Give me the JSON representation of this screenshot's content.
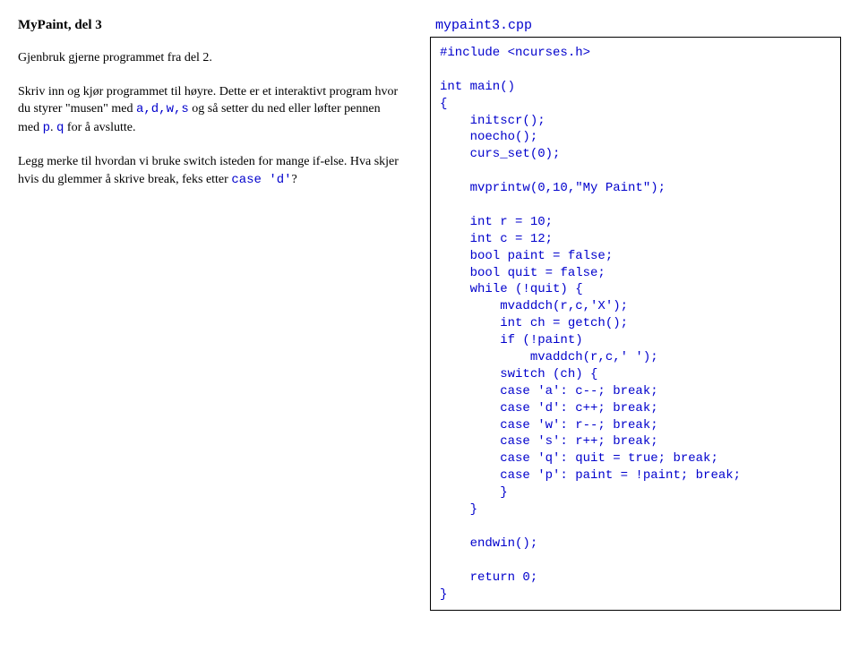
{
  "left": {
    "title": "MyPaint, del 3",
    "p1": "Gjenbruk gjerne programmet fra del 2.",
    "p2_1": "Skriv inn og kjør programmet til høyre. Dette er et interaktivt program hvor du styrer \"musen\" med ",
    "p2_code1": "a,d,w,s",
    "p2_2": " og så setter du ned eller løfter pennen med ",
    "p2_code2": "p",
    "p2_3": ". ",
    "p2_code3": "q",
    "p2_4": " for å avslutte.",
    "p3_1": "Legg merke til hvordan vi bruke switch isteden for mange if-else. Hva skjer hvis du glemmer å skrive break, feks etter ",
    "p3_code1": "case 'd'",
    "p3_2": "?"
  },
  "right": {
    "filename": "mypaint3.cpp",
    "code": "#include <ncurses.h>\n\nint main()\n{\n    initscr();\n    noecho();\n    curs_set(0);\n\n    mvprintw(0,10,\"My Paint\");\n\n    int r = 10;\n    int c = 12;\n    bool paint = false;\n    bool quit = false;\n    while (!quit) {\n        mvaddch(r,c,'X');\n        int ch = getch();\n        if (!paint)\n            mvaddch(r,c,' ');\n        switch (ch) {\n        case 'a': c--; break;\n        case 'd': c++; break;\n        case 'w': r--; break;\n        case 's': r++; break;\n        case 'q': quit = true; break;\n        case 'p': paint = !paint; break;\n        }\n    }\n\n    endwin();\n\n    return 0;\n}"
  }
}
